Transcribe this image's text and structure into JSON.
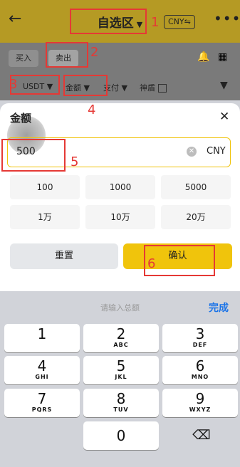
{
  "header": {
    "back_icon": "back-arrow-icon",
    "title": "自选区",
    "currency_button": "CNY⇋",
    "more_icon": "more-icon"
  },
  "tabs": {
    "buy": "买入",
    "sell": "卖出"
  },
  "filters": {
    "coin": "USDT ▼",
    "amount": "金额 ▼",
    "payment": "支付 ▼",
    "shield": "神盾"
  },
  "sheet": {
    "title": "金额",
    "amount_value": "500",
    "currency": "CNY",
    "presets": [
      "100",
      "1000",
      "5000",
      "1万",
      "10万",
      "20万"
    ],
    "reset": "重置",
    "confirm": "确认"
  },
  "keyboard": {
    "placeholder": "请输入总额",
    "done": "完成",
    "keys": [
      {
        "digit": "1",
        "letters": ""
      },
      {
        "digit": "2",
        "letters": "ABC"
      },
      {
        "digit": "3",
        "letters": "DEF"
      },
      {
        "digit": "4",
        "letters": "GHI"
      },
      {
        "digit": "5",
        "letters": "JKL"
      },
      {
        "digit": "6",
        "letters": "MNO"
      },
      {
        "digit": "7",
        "letters": "PQRS"
      },
      {
        "digit": "8",
        "letters": "TUV"
      },
      {
        "digit": "9",
        "letters": "WXYZ"
      },
      {
        "digit": "0",
        "letters": ""
      }
    ]
  },
  "annotations": [
    "1",
    "2",
    "3",
    "4",
    "5",
    "6"
  ],
  "colors": {
    "accent": "#f0c40c",
    "annotation": "#e53935",
    "done": "#1a73e8"
  }
}
